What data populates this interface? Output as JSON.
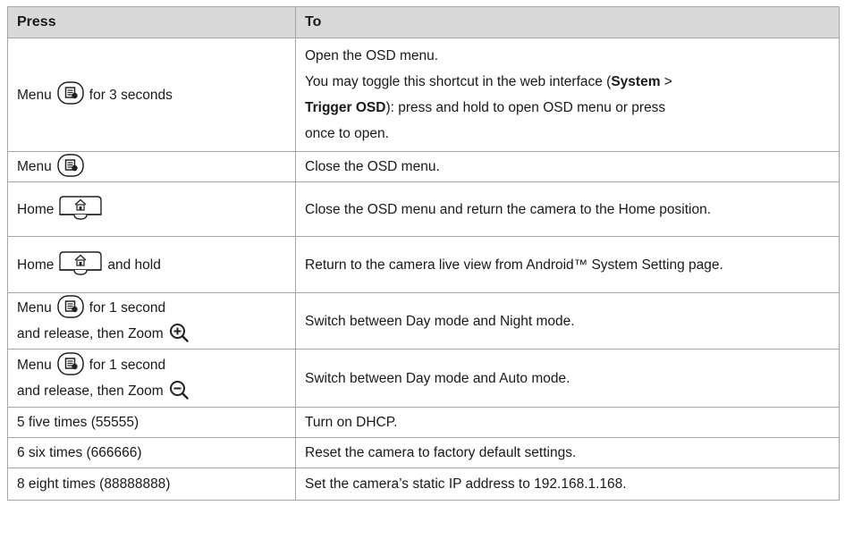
{
  "table": {
    "headers": {
      "press": "Press",
      "to": "To"
    },
    "rows": [
      {
        "press": {
          "before": "Menu",
          "key": "menu-key-icon",
          "after": "for 3 seconds"
        },
        "to": {
          "line1": "Open the OSD menu.",
          "line2_pre": "You may toggle this shortcut in the web interface (",
          "line2_bold1": "System",
          "line2_mid": " >",
          "line3_bold2": "Trigger OSD",
          "line3_post": "): press and hold to open OSD menu or press",
          "line4": "once to open."
        }
      },
      {
        "press": {
          "before": "Menu",
          "key": "menu-key-icon",
          "after": ""
        },
        "to": {
          "text": "Close the OSD menu."
        }
      },
      {
        "press": {
          "before": "Home",
          "key": "home-key-icon",
          "after": ""
        },
        "to": {
          "text": "Close the OSD menu and return the camera to the Home position."
        }
      },
      {
        "press": {
          "before": "Home",
          "key": "home-key-icon",
          "after": "and hold"
        },
        "to": {
          "text": "Return to the camera live view from Android™ System Setting page."
        }
      },
      {
        "press": {
          "before": "Menu",
          "key": "menu-key-icon",
          "after": "for 1 second",
          "line2": "and release, then Zoom",
          "zoom": "zoom-in-icon"
        },
        "to": {
          "text": "Switch between Day mode and Night mode."
        }
      },
      {
        "press": {
          "before": "Menu",
          "key": "menu-key-icon",
          "after": "for 1 second",
          "line2": "and release, then Zoom",
          "zoom": "zoom-out-icon"
        },
        "to": {
          "text": "Switch between Day mode and Auto mode."
        }
      },
      {
        "press": {
          "text": "5 five times (55555)"
        },
        "to": {
          "text": "Turn on DHCP."
        }
      },
      {
        "press": {
          "text": "6 six times (666666)"
        },
        "to": {
          "text": "Reset the camera to factory default settings."
        }
      },
      {
        "press": {
          "text": "8 eight times (88888888)"
        },
        "to": {
          "text": "Set the camera’s static IP address to 192.168.1.168."
        }
      }
    ]
  }
}
